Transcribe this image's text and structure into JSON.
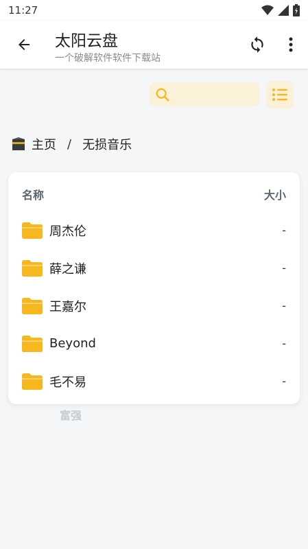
{
  "status": {
    "time": "11:27"
  },
  "appbar": {
    "title": "太阳云盘",
    "subtitle": "一个破解软件软件下载站"
  },
  "search": {
    "placeholder": ""
  },
  "breadcrumb": {
    "home": "主页",
    "separator": "/",
    "current": "无损音乐"
  },
  "table": {
    "header_name": "名称",
    "header_size": "大小",
    "rows": [
      {
        "name": "周杰伦",
        "size": "-"
      },
      {
        "name": "薛之谦",
        "size": "-"
      },
      {
        "name": "王嘉尔",
        "size": "-"
      },
      {
        "name": "Beyond",
        "size": "-"
      },
      {
        "name": "毛不易",
        "size": "-"
      }
    ]
  },
  "watermark": "富强",
  "colors": {
    "accent": "#f6b81e",
    "search_bg": "#fbf0d8",
    "background": "#f5f6f8"
  },
  "icons": {
    "back": "arrow-left-icon",
    "refresh": "refresh-icon",
    "menu": "more-vert-icon",
    "search": "search-icon",
    "list": "list-icon",
    "home": "kaaba-icon",
    "folder": "folder-icon"
  }
}
